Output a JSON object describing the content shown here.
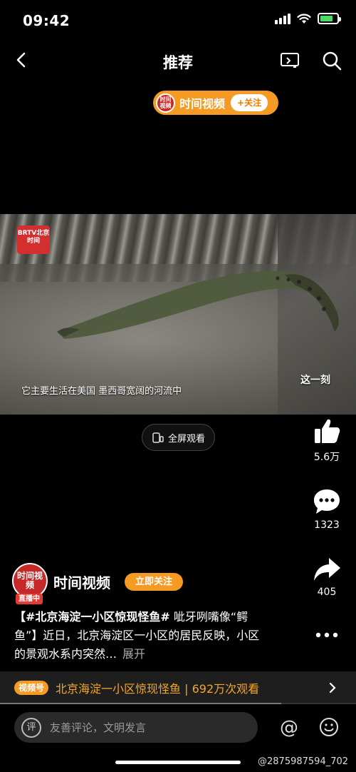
{
  "status_bar": {
    "time": "09:42",
    "battery_level": 0.75
  },
  "topbar": {
    "title": "推荐"
  },
  "account_pill": {
    "logo_text": "时间视频",
    "name": "时间视频",
    "follow_label": "+关注"
  },
  "video": {
    "logo_text": "BRTV北京时间",
    "caption": "它主要生活在美国 墨西哥宽阔的河流中",
    "watermark": "这一刻"
  },
  "fullscreen": {
    "label": "全屏观看"
  },
  "actions": {
    "like_count": "5.6万",
    "comment_count": "1323",
    "share_count": "405"
  },
  "author": {
    "avatar_text": "时间视频",
    "live_label": "直播中",
    "name": "时间视频",
    "follow_label": "立即关注"
  },
  "description": {
    "tag": "【#北京海淀一小区惊现怪鱼#",
    "text": " 呲牙咧嘴像“鳄鱼”】近日，北京海淀区一小区的居民反映，小区的景观水系内突然…",
    "expand": "展开"
  },
  "series": {
    "badge": "视频号",
    "text": "北京海淀一小区惊现怪鱼 | 692万次观看"
  },
  "progress_value": 0.79,
  "comment": {
    "icon_text": "评",
    "placeholder": "友善评论，文明发言"
  },
  "footer": {
    "user_watermark": "@2875987594_702"
  }
}
